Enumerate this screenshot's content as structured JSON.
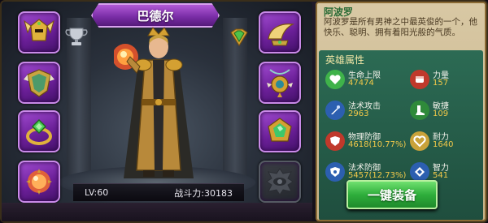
{
  "hero_panel": {
    "title": "巴德尔",
    "level": "LV:60",
    "power": "战斗力:30183"
  },
  "equipment_slots": [
    {
      "id": "helmet",
      "icon": "winged-helmet-icon"
    },
    {
      "id": "armor",
      "icon": "shield-armor-icon"
    },
    {
      "id": "ring",
      "icon": "green-gem-ring-icon"
    },
    {
      "id": "orb",
      "icon": "fire-orb-icon"
    },
    {
      "id": "wings",
      "icon": "golden-wings-icon"
    },
    {
      "id": "amulet",
      "icon": "amulet-icon"
    },
    {
      "id": "emerald",
      "icon": "emerald-jewel-icon"
    },
    {
      "id": "locked",
      "icon": "locked-eye-icon"
    }
  ],
  "info_panel": {
    "name": "阿波罗",
    "description": "阿波罗是所有男神之中最英俊的一个，他快乐、聪明、拥有着阳光般的气质。",
    "attributes_title": "英雄属性",
    "attributes": [
      {
        "name": "生命上限",
        "value": "47474",
        "icon": "heart-icon",
        "color": "#3fb24a"
      },
      {
        "name": "力量",
        "value": "157",
        "icon": "fist-icon",
        "color": "#c0392b"
      },
      {
        "name": "法术攻击",
        "value": "2963",
        "icon": "magic-attack-icon",
        "color": "#2c5fb0"
      },
      {
        "name": "敏捷",
        "value": "109",
        "icon": "boot-icon",
        "color": "#2f8a3a"
      },
      {
        "name": "物理防御",
        "value": "4618(10.77%)",
        "icon": "physical-defense-icon",
        "color": "#c0392b"
      },
      {
        "name": "耐力",
        "value": "1640",
        "icon": "endurance-heart-icon",
        "color": "#c9a23a"
      },
      {
        "name": "法术防御",
        "value": "5457(12.73%)",
        "icon": "magic-defense-icon",
        "color": "#2c5fb0"
      },
      {
        "name": "智力",
        "value": "541",
        "icon": "intellect-icon",
        "color": "#2c5fb0"
      }
    ]
  },
  "equip_button": {
    "label": "一键装备"
  },
  "colors": {
    "banner": "#7b2ea8",
    "slot": "#6b1f98",
    "attr_panel": "#2c6b54",
    "value": "#f2c94a",
    "button": "#2fae3c"
  }
}
